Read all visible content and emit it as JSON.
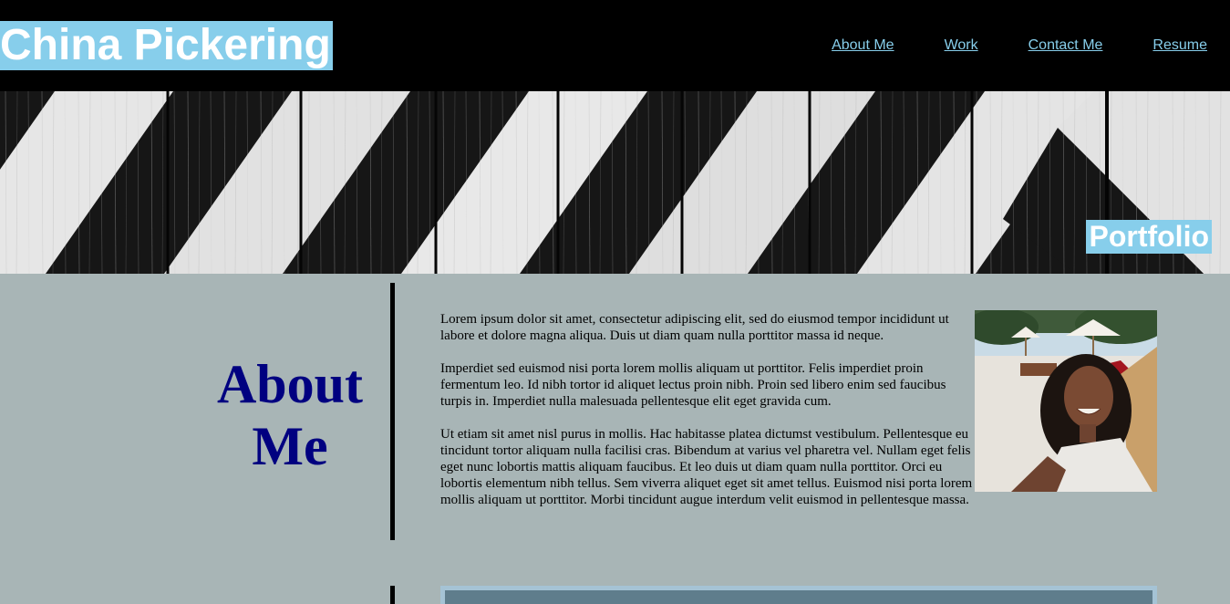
{
  "header": {
    "title": "China Pickering",
    "nav": [
      {
        "label": "About Me"
      },
      {
        "label": "Work"
      },
      {
        "label": "Contact Me"
      },
      {
        "label": "Resume"
      }
    ]
  },
  "hero": {
    "label": "Portfolio"
  },
  "about": {
    "heading": "About Me",
    "paragraphs": [
      "Lorem ipsum dolor sit amet, consectetur adipiscing elit, sed do eiusmod tempor incididunt ut labore et dolore magna aliqua. Duis ut diam quam nulla porttitor massa id neque.",
      "Imperdiet sed euismod nisi porta lorem mollis aliquam ut porttitor. Felis imperdiet proin fermentum leo. Id nibh tortor id aliquet lectus proin nibh. Proin sed libero enim sed faucibus turpis in. Imperdiet nulla malesuada pellentesque elit eget gravida cum.",
      "Ut etiam sit amet nisl purus in mollis. Hac habitasse platea dictumst vestibulum. Pellentesque eu tincidunt tortor aliquam nulla facilisi cras. Bibendum at varius vel pharetra vel. Nullam eget felis eget nunc lobortis mattis aliquam faucibus. Et leo duis ut diam quam nulla porttitor. Orci eu lobortis elementum nibh tellus. Sem viverra aliquet eget sit amet tellus. Euismod nisi porta lorem mollis aliquam ut porttitor. Morbi tincidunt augue interdum velit euismod in pellentesque massa."
    ]
  },
  "colors": {
    "accent": "#87ceeb",
    "page_background": "#a8b5b6",
    "heading": "#000080",
    "header_background": "#000000"
  }
}
